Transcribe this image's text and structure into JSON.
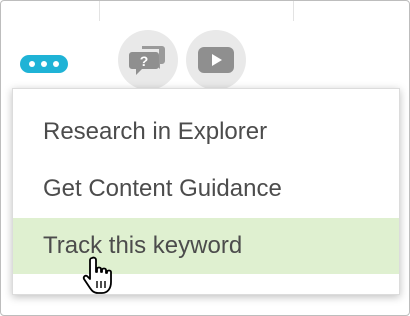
{
  "toolbar": {
    "more_icon": "more-dots-icon",
    "help_icon": "question-chat-icon",
    "video_icon": "play-video-icon",
    "accent_color": "#1fb3d6"
  },
  "menu": {
    "items": [
      {
        "label": "Research in Explorer",
        "highlighted": false
      },
      {
        "label": "Get Content Guidance",
        "highlighted": false
      },
      {
        "label": "Track this keyword",
        "highlighted": true
      }
    ],
    "highlight_color": "#dff0d0"
  },
  "cursor": {
    "icon": "hand-pointer-icon"
  }
}
